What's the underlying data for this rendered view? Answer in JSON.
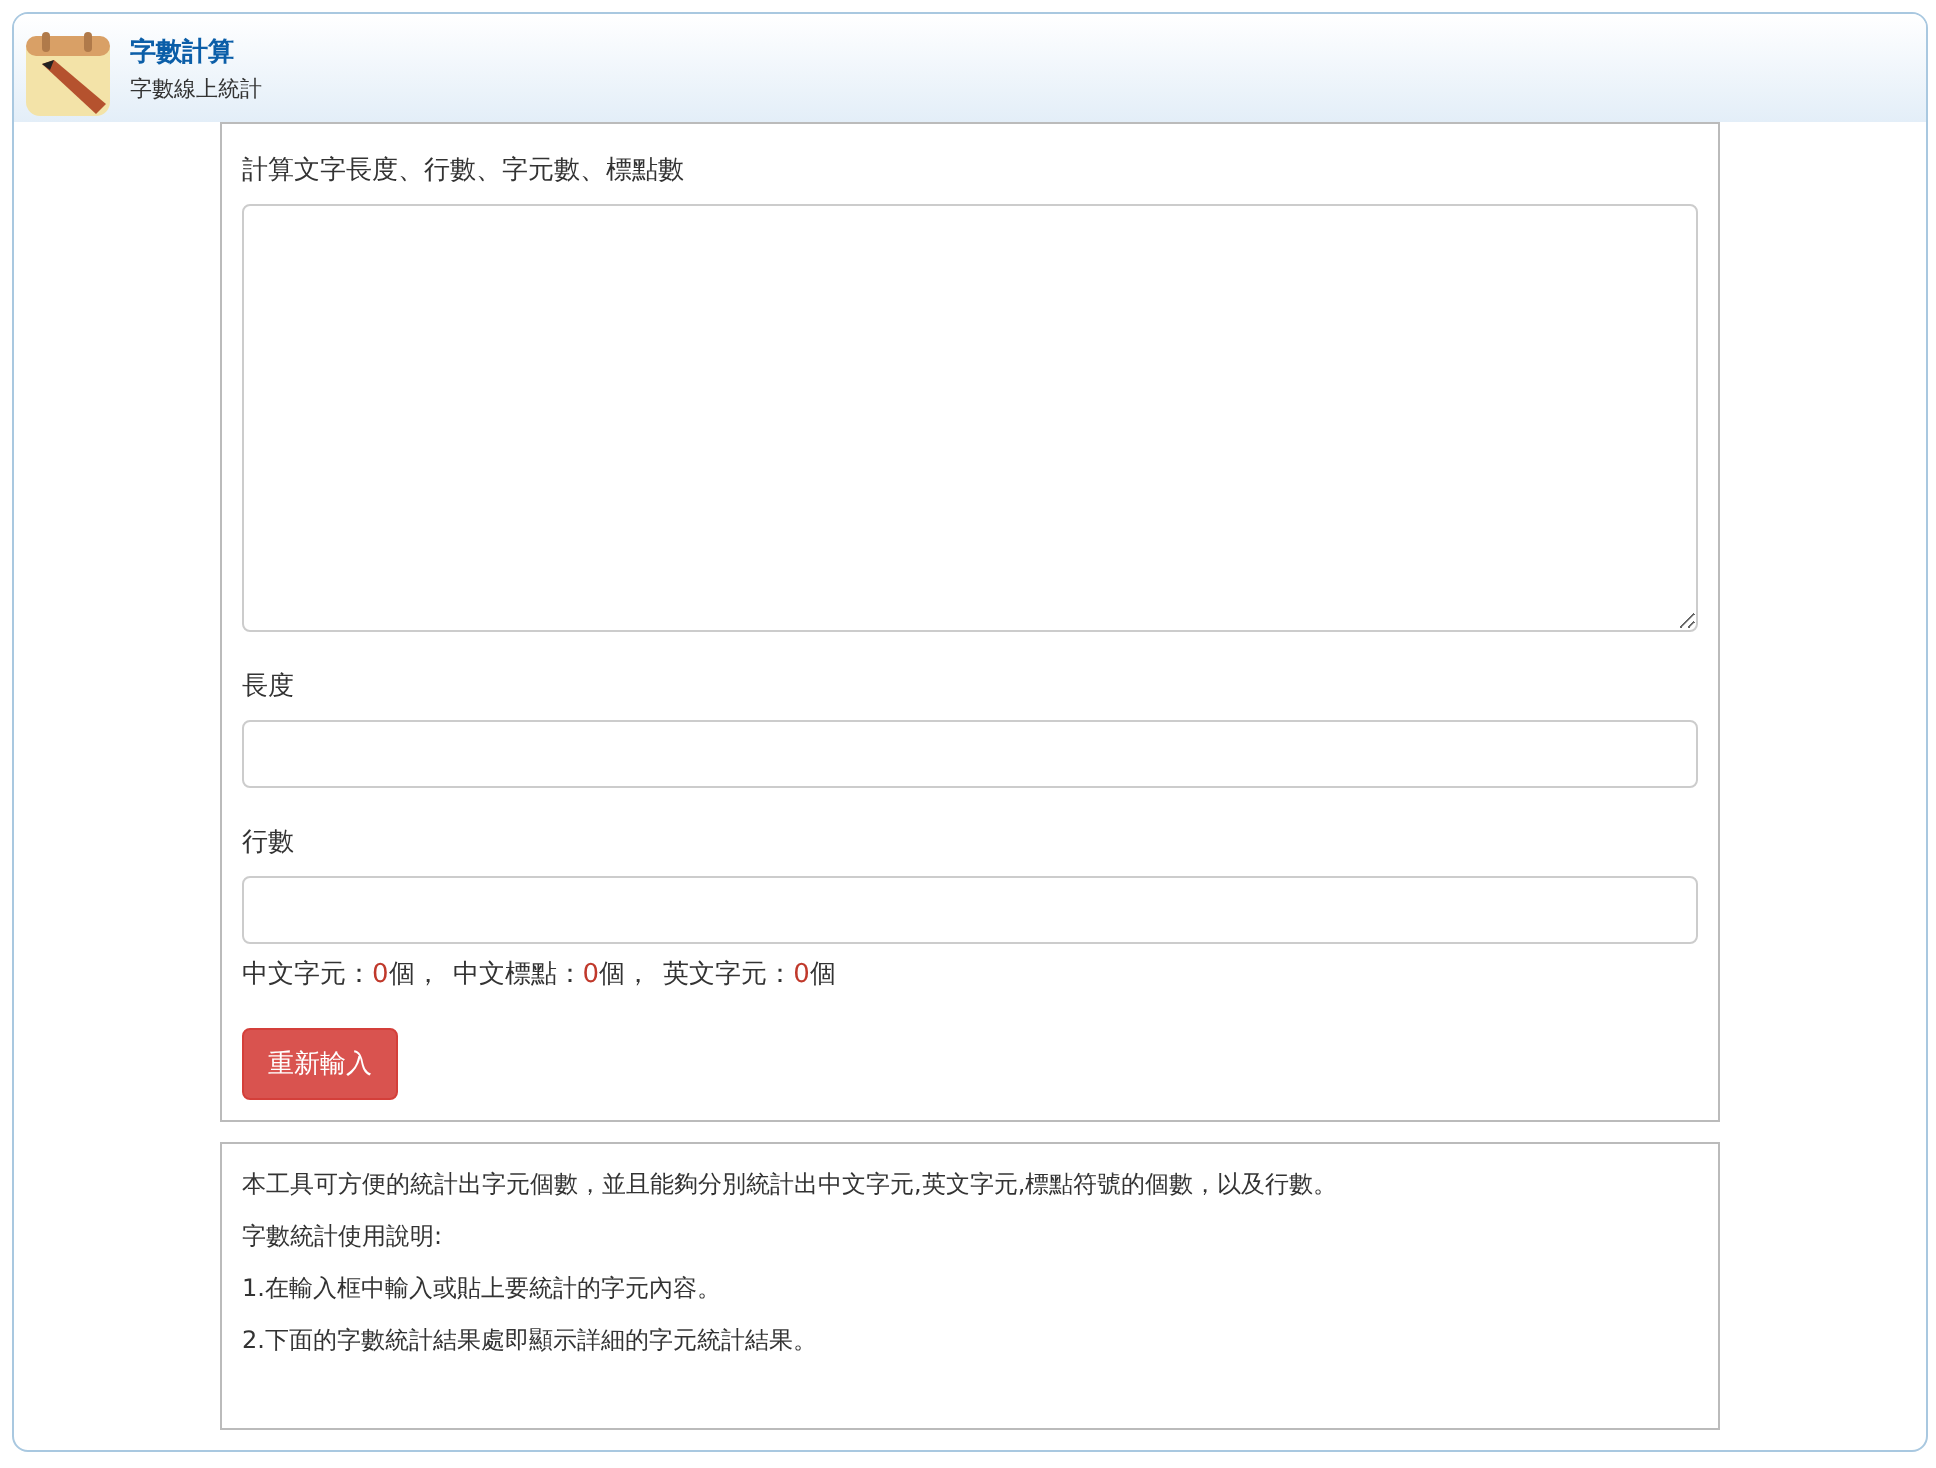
{
  "header": {
    "title": "字數計算",
    "subtitle": "字數線上統計"
  },
  "form": {
    "prompt": "計算文字長度、行數、字元數、標點數",
    "fields": [
      {
        "label": "長度"
      },
      {
        "label": "行數"
      }
    ],
    "stats": [
      {
        "label": "中文字元：",
        "value": "0",
        "unit": "個，"
      },
      {
        "label": "中文標點：",
        "value": "0",
        "unit": "個，"
      },
      {
        "label": "英文字元：",
        "value": "0",
        "unit": "個"
      }
    ],
    "reset_button": "重新輸入"
  },
  "info": [
    "本工具可方便的統計出字元個數，並且能夠分別統計出中文字元,英文字元,標點符號的個數，以及行數。",
    "字數統計使用說明:",
    "1.在輸入框中輸入或貼上要統計的字元內容。",
    "2.下面的字數統計結果處即顯示詳細的字元統計結果。"
  ]
}
